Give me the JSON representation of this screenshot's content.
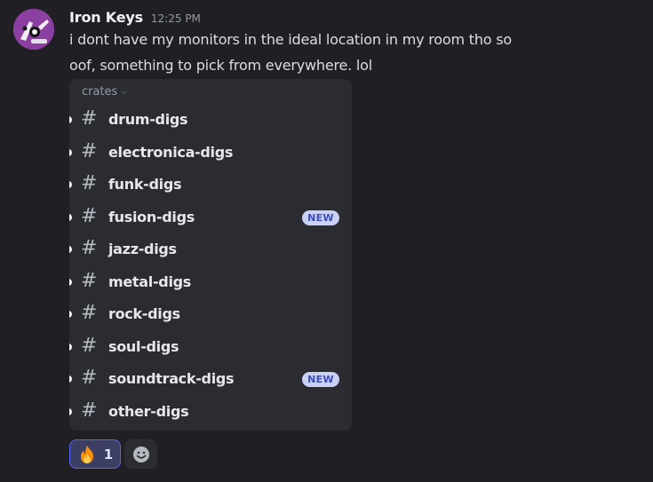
{
  "author": {
    "username": "Iron Keys",
    "timestamp": "12:25 PM"
  },
  "message": {
    "lines": [
      "i dont have my monitors in the ideal location in my room tho so",
      "oof, something to pick from everywhere. lol"
    ]
  },
  "channel_card": {
    "category": "crates",
    "category_icon": "chevron-down-icon",
    "channel_icon": "hash-icon",
    "new_label": "NEW",
    "channels": [
      {
        "name": "drum-digs",
        "new": false
      },
      {
        "name": "electronica-digs",
        "new": false
      },
      {
        "name": "funk-digs",
        "new": false
      },
      {
        "name": "fusion-digs",
        "new": true
      },
      {
        "name": "jazz-digs",
        "new": false
      },
      {
        "name": "metal-digs",
        "new": false
      },
      {
        "name": "rock-digs",
        "new": false
      },
      {
        "name": "soul-digs",
        "new": false
      },
      {
        "name": "soundtrack-digs",
        "new": true
      },
      {
        "name": "other-digs",
        "new": false
      }
    ]
  },
  "reactions": [
    {
      "emoji": "fire-emoji",
      "count": "1",
      "selected": true
    }
  ],
  "add_reaction_icon": "smiley-add-icon",
  "colors": {
    "background": "#1f1f24",
    "card": "#2b2c31",
    "accent": "#5865f2",
    "badge_bg": "#c9d1f7",
    "badge_text": "#3d4db8"
  }
}
